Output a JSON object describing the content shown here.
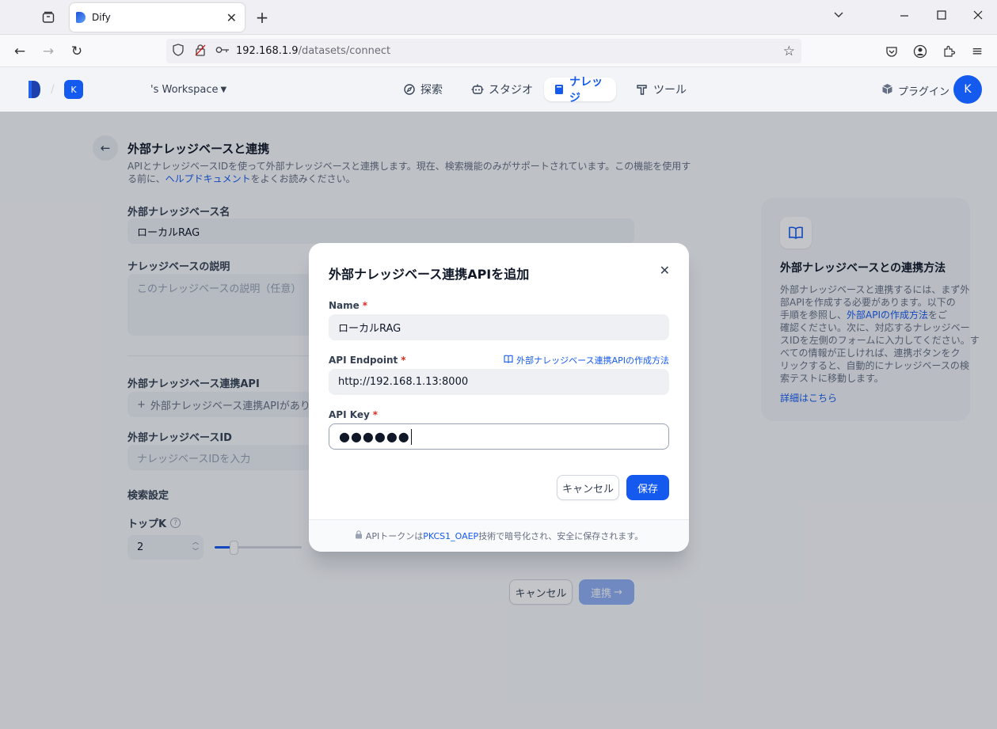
{
  "browser": {
    "tab_title": "Dify",
    "url_host": "192.168.1.9",
    "url_path": "/datasets/connect"
  },
  "header": {
    "workspace_avatar": "K",
    "workspace_name": "'s Workspace",
    "nav": [
      {
        "label": "探索",
        "icon": "compass-icon"
      },
      {
        "label": "スタジオ",
        "icon": "robot-icon"
      },
      {
        "label": "ナレッジ",
        "icon": "book-icon",
        "active": true
      },
      {
        "label": "ツール",
        "icon": "hammer-icon"
      }
    ],
    "plugin_label": "プラグイン",
    "user_avatar": "K"
  },
  "page": {
    "title": "外部ナレッジベースと連携",
    "desc_line1": "APIとナレッジベースIDを使って外部ナレッジベースと連携します。現在、検索機能のみがサポートされています。この機能を使用す",
    "desc_line2_pre": "る前に、",
    "desc_link": "ヘルプドキュメント",
    "desc_line2_post": "をよくお読みください。",
    "kb_name_label": "外部ナレッジベース名",
    "kb_name_value": "ローカルRAG",
    "kb_desc_label": "ナレッジベースの説明",
    "kb_desc_placeholder": "このナレッジベースの説明（任意）",
    "api_label": "外部ナレッジベース連携API",
    "api_empty": "外部ナレッジベース連携APIがありません",
    "kb_id_label": "外部ナレッジベースID",
    "kb_id_placeholder": "ナレッジベースIDを入力",
    "retrieval_label": "検索設定",
    "topk_label": "トップK",
    "topk_value": "2",
    "cancel": "キャンセル",
    "connect": "連携"
  },
  "info": {
    "title": "外部ナレッジベースとの連携方法",
    "body_1": "外部ナレッジベースと連携するには、まず外",
    "body_2": "部APIを作成する必要があります。以下の",
    "body_3_pre": "手順を参照し、",
    "body_3_link": "外部APIの作成方法",
    "body_3_post": "をご",
    "body_4": "確認ください。次に、対応するナレッジベー",
    "body_5": "スIDを左側のフォームに入力してください。す",
    "body_6": "べての情報が正しければ、連携ボタンをク",
    "body_7": "リックすると、自動的にナレッジベースの検",
    "body_8": "索テストに移動します。",
    "more": "詳細はこちら"
  },
  "modal": {
    "title": "外部ナレッジベース連携APIを追加",
    "name_label": "Name",
    "name_value": "ローカルRAG",
    "endpoint_label": "API Endpoint",
    "endpoint_help": "外部ナレッジベース連携APIの作成方法",
    "endpoint_value": "http://192.168.1.13:8000",
    "key_label": "API Key",
    "key_value": "●●●●●●",
    "required_mark": "*",
    "cancel": "キャンセル",
    "save": "保存",
    "footer_pre": "APIトークンは ",
    "footer_link": "PKCS1_OAEP",
    "footer_post": " 技術で暗号化され、安全に保存されます。"
  }
}
